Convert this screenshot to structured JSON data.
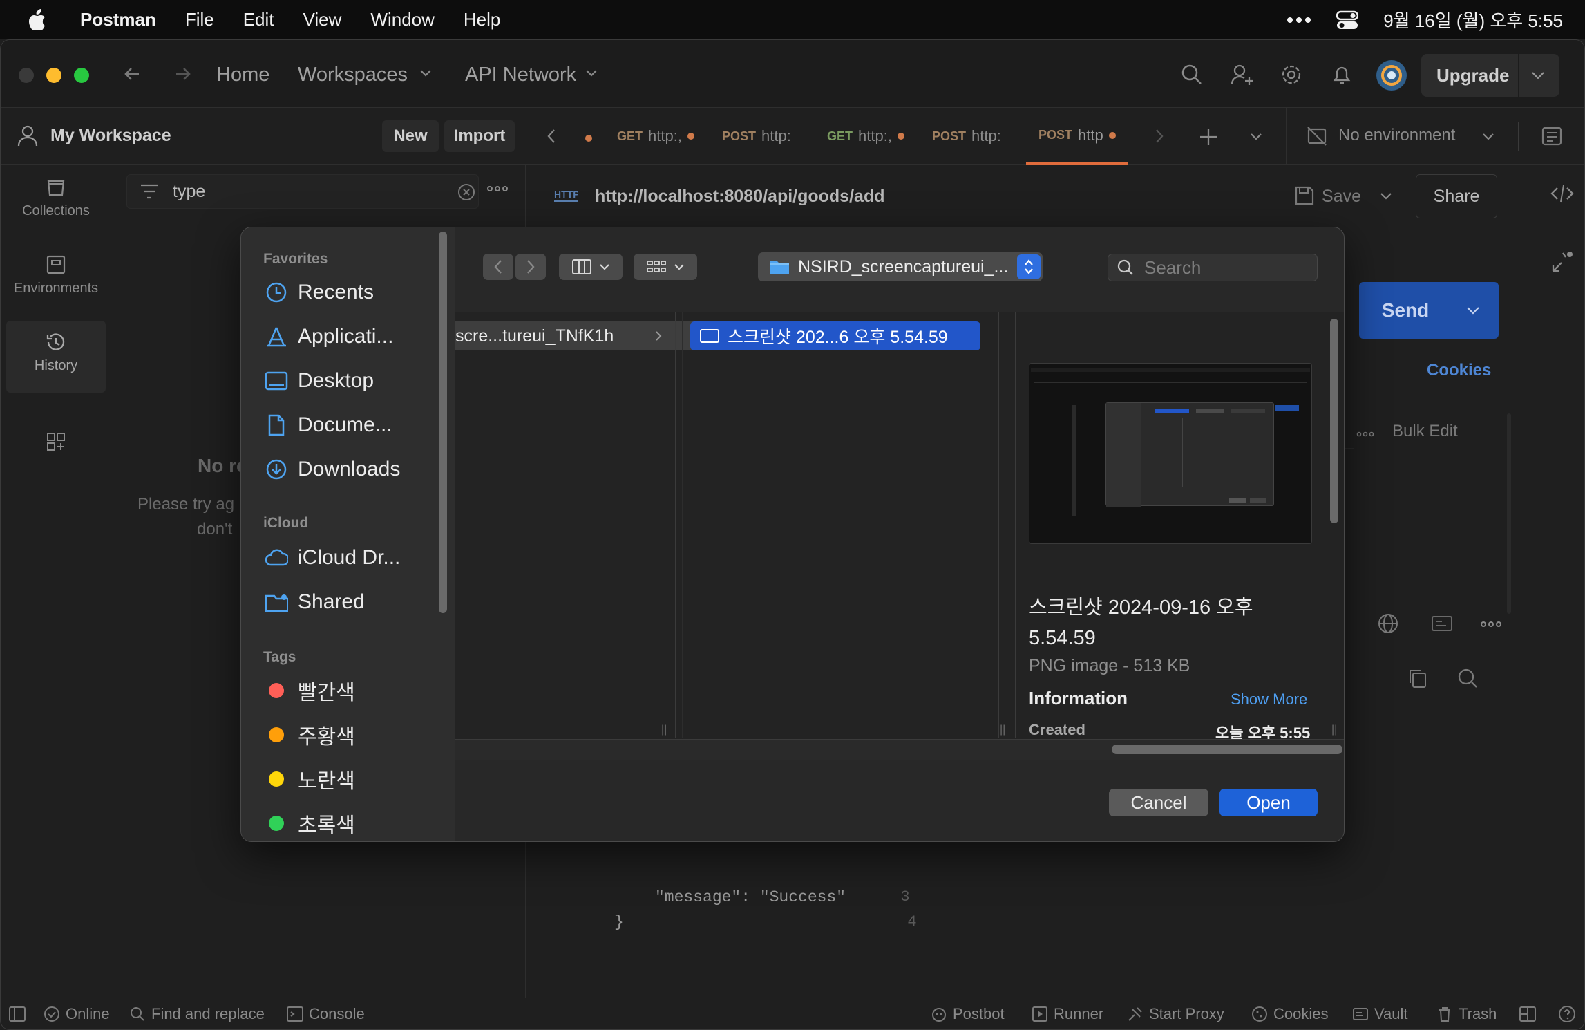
{
  "menubar": {
    "app": "Postman",
    "items": [
      "File",
      "Edit",
      "View",
      "Window",
      "Help"
    ],
    "clock": "9월 16일 (월) 오후 5:55"
  },
  "titlebar": {
    "home": "Home",
    "workspaces": "Workspaces",
    "api_network": "API Network",
    "upgrade": "Upgrade"
  },
  "workspace": {
    "name": "My Workspace",
    "new_label": "New",
    "import_label": "Import",
    "tabs": [
      {
        "method": "GET",
        "label": "http:,"
      },
      {
        "method": "POST",
        "label": "http:"
      },
      {
        "method": "GET",
        "label": "http:,"
      },
      {
        "method": "POST",
        "label": "http:"
      },
      {
        "method": "POST",
        "label": "http"
      }
    ],
    "environment": "No environment"
  },
  "rail": [
    "Collections",
    "Environments",
    "History"
  ],
  "history": {
    "search_value": "type",
    "empty_title": "No re",
    "empty_line1": "Please try ag",
    "empty_line2": "don't"
  },
  "request": {
    "url": "http://localhost:8080/api/goods/add",
    "save": "Save",
    "share": "Share",
    "send": "Send",
    "cookies": "Cookies",
    "bulk_edit": "Bulk Edit",
    "code_lines": [
      {
        "num": "3",
        "text": "\"message\": \"Success\""
      },
      {
        "num": "4",
        "text": "}"
      }
    ]
  },
  "dialog": {
    "favorites_header": "Favorites",
    "favorites": [
      "Recents",
      "Applicati...",
      "Desktop",
      "Docume...",
      "Downloads"
    ],
    "icloud_header": "iCloud",
    "icloud": [
      "iCloud Dr...",
      "Shared"
    ],
    "tags_header": "Tags",
    "tags": [
      {
        "name": "빨간색",
        "color": "#ff5f57"
      },
      {
        "name": "주황색",
        "color": "#ff9f0a"
      },
      {
        "name": "노란색",
        "color": "#ffd60a"
      },
      {
        "name": "초록색",
        "color": "#30d158"
      }
    ],
    "path_label": "NSIRD_screencaptureui_...",
    "search_placeholder": "Search",
    "col1_item": "scre...tureui_TNfK1h",
    "col2_item": "스크린샷 202...6 오후 5.54.59",
    "preview_name_line1": "스크린샷 2024-09-16 오후",
    "preview_name_line2": "5.54.59",
    "preview_kind": "PNG image - 513 KB",
    "information": "Information",
    "show_more": "Show More",
    "created_label": "Created",
    "created_value": "오늘 오후 5:55",
    "cancel": "Cancel",
    "open": "Open"
  },
  "statusbar": {
    "left": [
      "Online",
      "Find and replace",
      "Console"
    ],
    "right": [
      "Postbot",
      "Runner",
      "Start Proxy",
      "Cookies",
      "Vault",
      "Trash"
    ]
  },
  "colors": {
    "accent_blue": "#1e62d8",
    "send_blue": "#1f4fa8",
    "selection_blue": "#2256c9",
    "folder_blue": "#4ea3f0"
  }
}
